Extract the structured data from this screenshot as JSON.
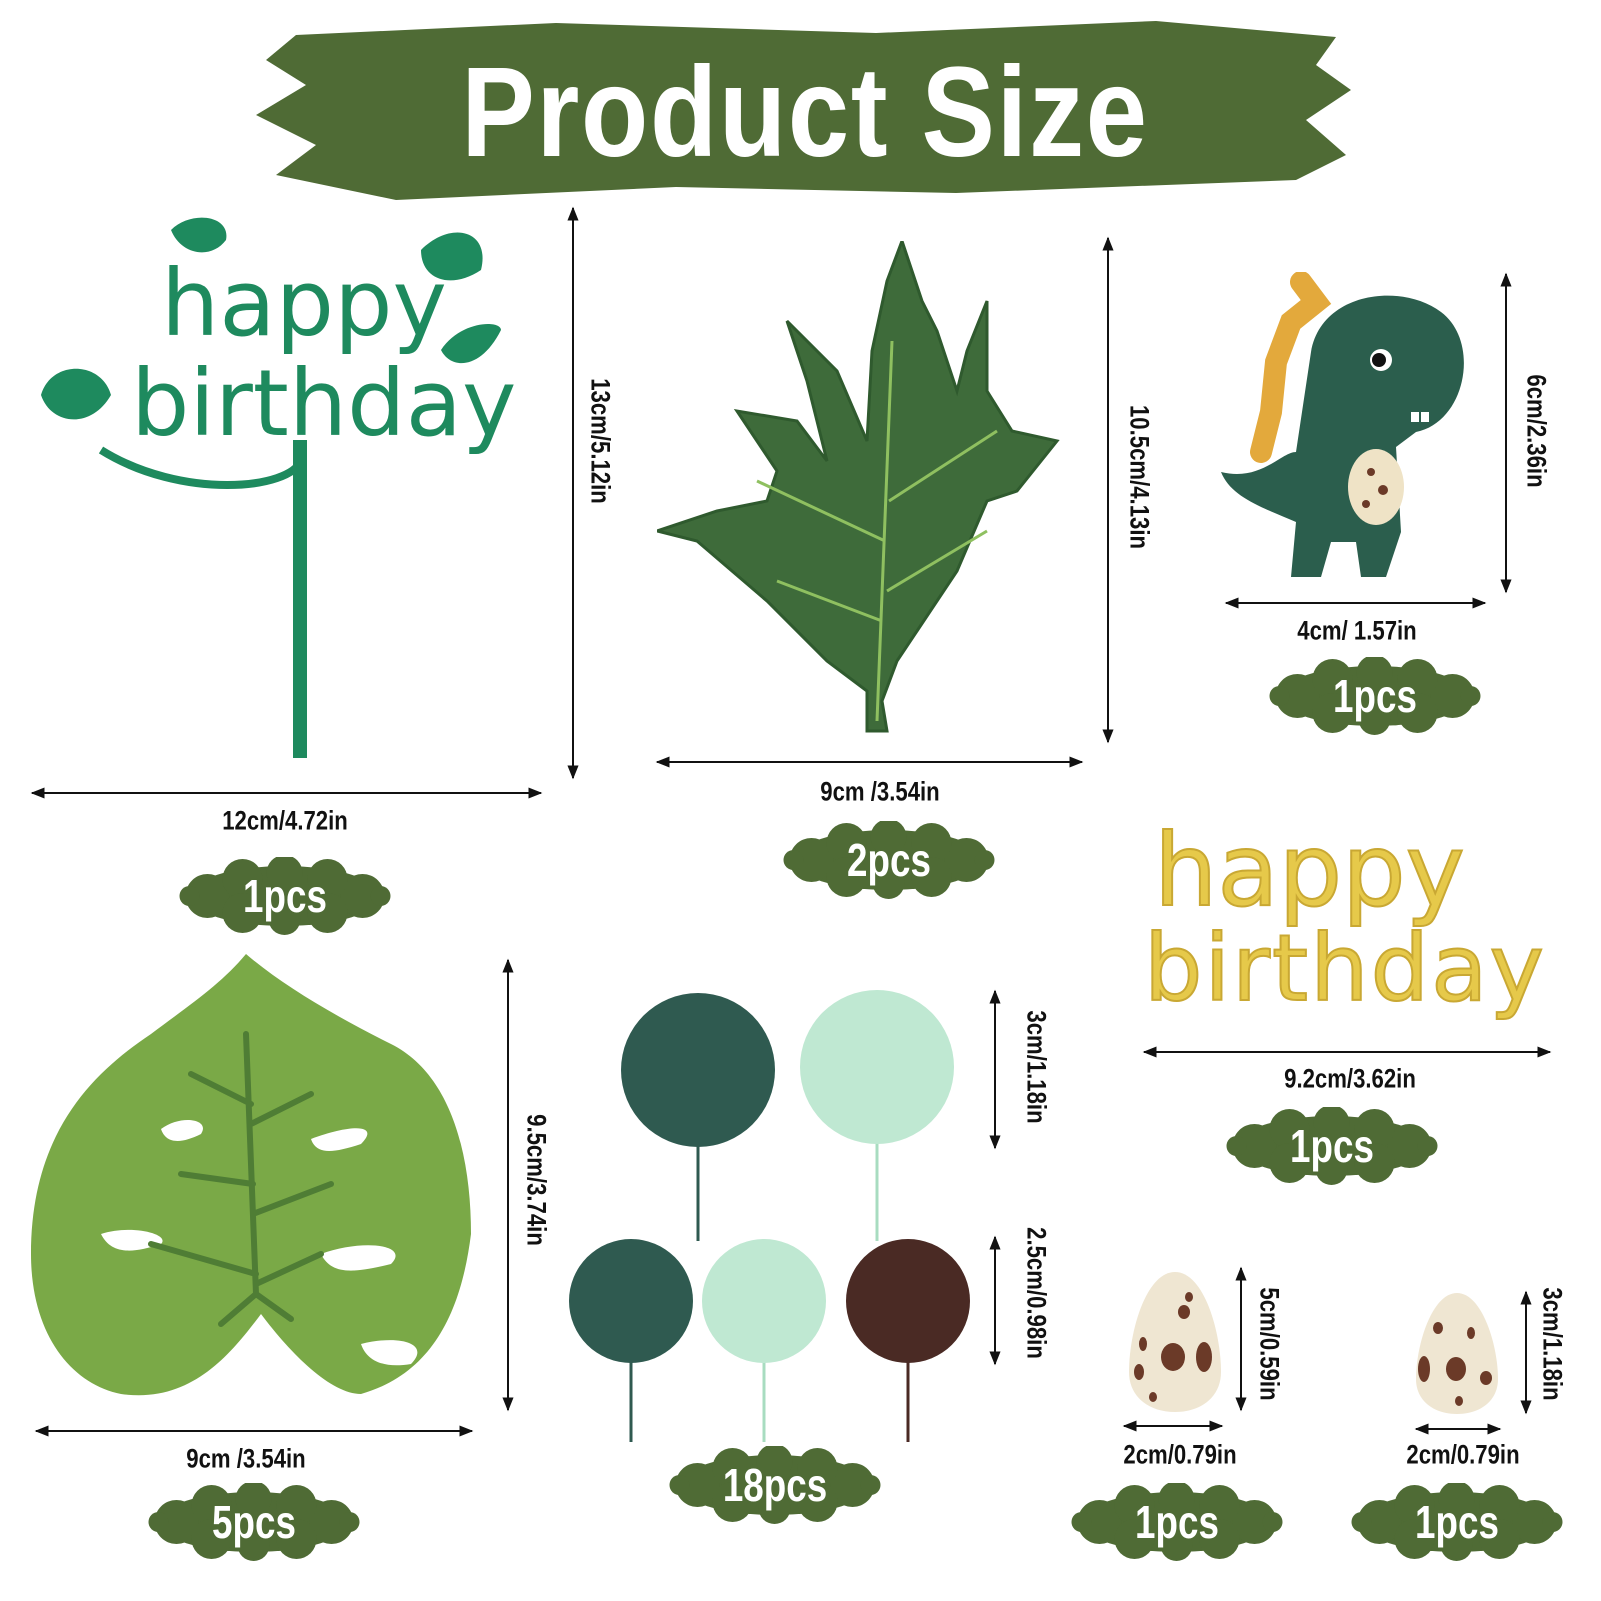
{
  "title": "Product Size",
  "colors": {
    "banner": "#4f6b35",
    "badge": "#4f6b35",
    "topper_green": "#1e8a5e",
    "topper_gold": "#e6c94a",
    "dark_ball": "#2f5a50",
    "mint_ball": "#bfe8d2",
    "brown_ball": "#4a2a24"
  },
  "items": {
    "green_topper": {
      "text1": "happy",
      "text2": "birthday",
      "height": "13cm/5.12in",
      "width": "12cm/4.72in",
      "qty": "1pcs"
    },
    "maple_leaf": {
      "height": "10.5cm/4.13in",
      "width": "9cm /3.54in",
      "qty": "2pcs"
    },
    "dinosaur": {
      "height": "6cm/2.36in",
      "width": "4cm/ 1.57in",
      "qty": "1pcs"
    },
    "gold_topper": {
      "text1": "happy",
      "text2": "birthday",
      "width": "9.2cm/3.62in",
      "qty": "1pcs"
    },
    "monstera_leaf": {
      "height": "9.5cm/3.74in",
      "width": "9cm /3.54in",
      "qty": "5pcs"
    },
    "balls": {
      "large_size": "3cm/1.18in",
      "small_size": "2.5cm/0.98in",
      "qty": "18pcs"
    },
    "egg_large": {
      "height": "5cm/0.59in",
      "width": "2cm/0.79in",
      "qty": "1pcs"
    },
    "egg_small": {
      "height": "3cm/1.18in",
      "width": "2cm/0.79in",
      "qty": "1pcs"
    }
  }
}
